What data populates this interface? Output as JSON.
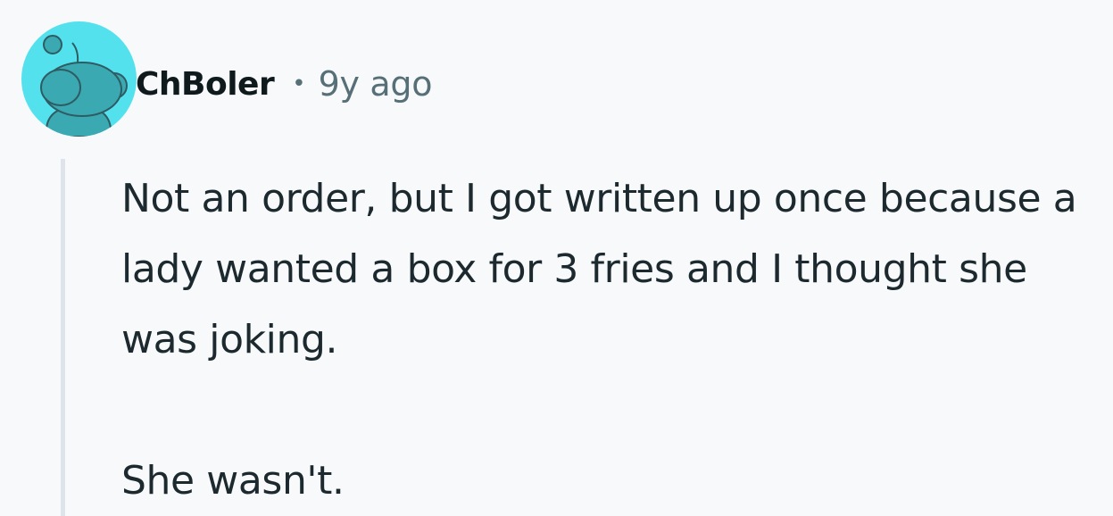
{
  "comment": {
    "author": "ChBoler",
    "separator": "•",
    "timestamp": "9y ago",
    "avatar_icon": "snoo-avatar-icon",
    "colors": {
      "avatar_bg": "#54e1ee",
      "avatar_figure": "#3aa9b2",
      "author_text": "#0f1a1c",
      "meta_text": "#576f76",
      "body_text": "#1c2a2f",
      "thread_line": "#dfe3ea",
      "page_bg": "#f8f9fb"
    },
    "paragraphs": [
      "Not an order, but I got written up once because a lady wanted a box for 3 fries and I thought she was joking.",
      "She wasn't."
    ]
  }
}
